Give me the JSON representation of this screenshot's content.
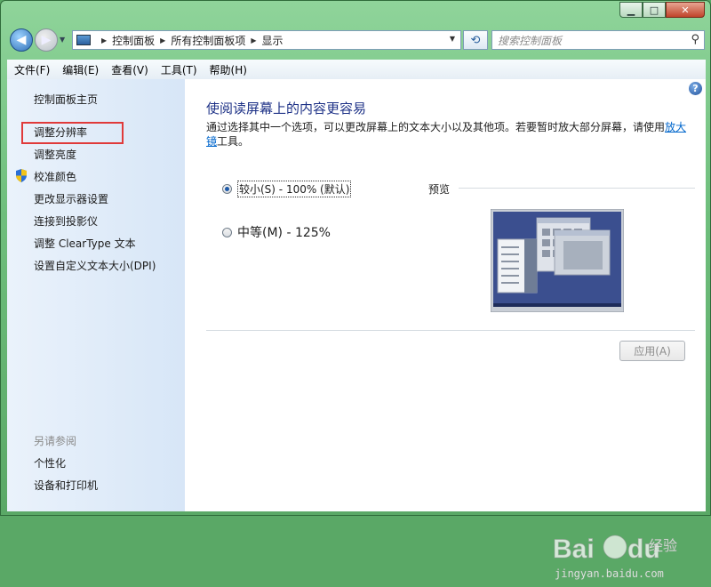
{
  "window": {
    "minimize": "▁",
    "maximize": "□",
    "close": "✕"
  },
  "address": {
    "crumbs": [
      "控制面板",
      "所有控制面板项",
      "显示"
    ],
    "search_placeholder": "搜索控制面板"
  },
  "menubar": {
    "items": [
      "文件(F)",
      "编辑(E)",
      "查看(V)",
      "工具(T)",
      "帮助(H)"
    ]
  },
  "sidebar": {
    "items": [
      "控制面板主页",
      "调整分辨率",
      "调整亮度",
      "校准颜色",
      "更改显示器设置",
      "连接到投影仪",
      "调整 ClearType 文本",
      "设置自定义文本大小(DPI)"
    ],
    "see_also_title": "另请参阅",
    "see_also_items": [
      "个性化",
      "设备和打印机"
    ]
  },
  "main": {
    "title": "使阅读屏幕上的内容更容易",
    "description_pre": "通过选择其中一个选项，可以更改屏幕上的文本大小以及其他项。若要暂时放大部分屏幕，请使用",
    "description_link": "放大镜",
    "description_post": "工具。",
    "options": [
      {
        "label": "较小(S) - 100% (默认)",
        "selected": true
      },
      {
        "label": "中等(M) - 125%",
        "selected": false
      }
    ],
    "preview_label": "预览",
    "apply_label": "应用(A)"
  },
  "watermark": {
    "brand": "Bai du 经验",
    "url": "jingyan.baidu.com"
  },
  "colors": {
    "accent_title": "#1e3287",
    "link": "#0066cc",
    "highlight": "#e03a3a"
  }
}
